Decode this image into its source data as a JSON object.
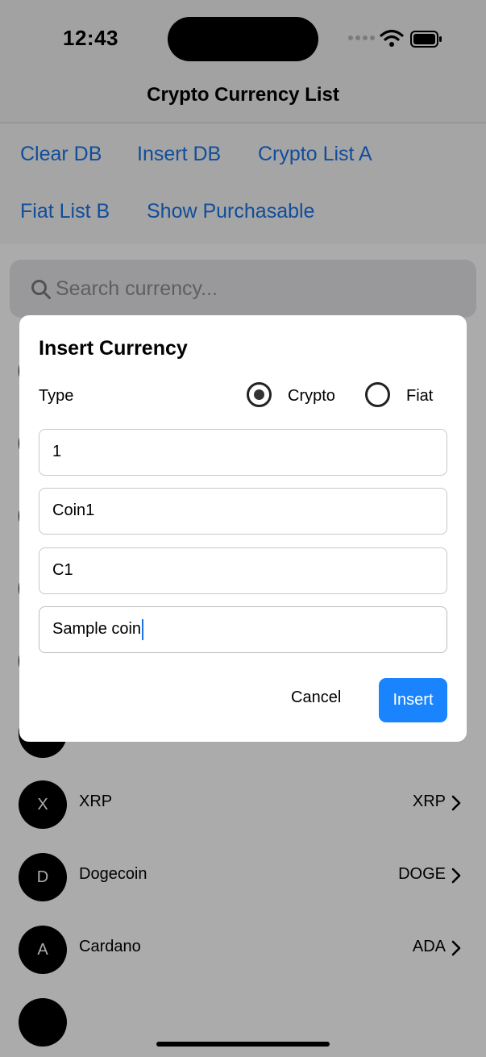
{
  "status_bar": {
    "time": "12:43"
  },
  "nav": {
    "title": "Crypto Currency List"
  },
  "toolbar": {
    "clear_db": "Clear DB",
    "insert_db": "Insert DB",
    "crypto_list_a": "Crypto List A",
    "fiat_list_b": "Fiat List B",
    "show_purchasable": "Show Purchasable"
  },
  "search": {
    "placeholder": "Search currency..."
  },
  "list": {
    "items": [
      {
        "initial": "X",
        "name": "XRP",
        "symbol": "XRP"
      },
      {
        "initial": "D",
        "name": "Dogecoin",
        "symbol": "DOGE"
      },
      {
        "initial": "A",
        "name": "Cardano",
        "symbol": "ADA"
      }
    ]
  },
  "dialog": {
    "title": "Insert Currency",
    "type_label": "Type",
    "options": [
      {
        "label": "Crypto",
        "selected": true
      },
      {
        "label": "Fiat",
        "selected": false
      }
    ],
    "fields": [
      {
        "value": "1"
      },
      {
        "value": "Coin1"
      },
      {
        "value": "C1"
      },
      {
        "value": "Sample coin"
      }
    ],
    "cancel_label": "Cancel",
    "insert_label": "Insert"
  },
  "colors": {
    "link": "#1a73e8",
    "primary_button": "#1a84ff",
    "avatar": "#000000"
  }
}
